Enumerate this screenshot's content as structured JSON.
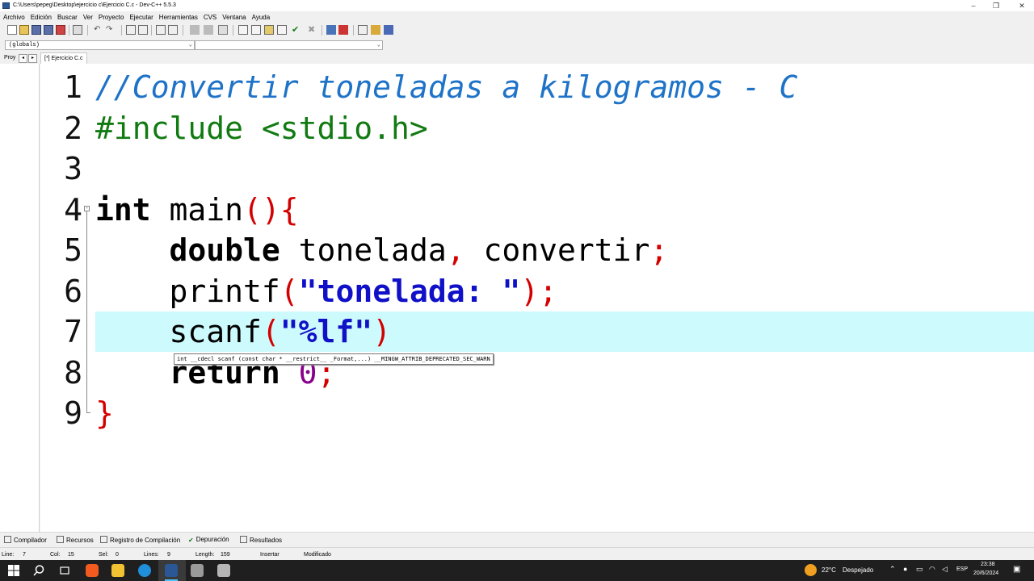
{
  "window": {
    "title": "C:\\Users\\pepeg\\Desktop\\ejercicio  c\\Ejercicio C.c - Dev-C++ 5.5.3",
    "controls": [
      "–",
      "❐",
      "✕"
    ]
  },
  "menu": [
    "Archivo",
    "Edición",
    "Buscar",
    "Ver",
    "Proyecto",
    "Ejecutar",
    "Herramientas",
    "CVS",
    "Ventana",
    "Ayuda"
  ],
  "selectors": {
    "scope": "(globals)",
    "member": ""
  },
  "tabs": {
    "project_tab": "Proy",
    "file_tab": "[*] Ejercicio C.c"
  },
  "editor": {
    "line_numbers": [
      "1",
      "2",
      "3",
      "4",
      "5",
      "6",
      "7",
      "8",
      "9"
    ],
    "lines": {
      "l1_comment": "//Convertir toneladas a kilogramos - C",
      "l2_include": "#include <stdio.h>",
      "l4_type": "int",
      "l4_name": " main",
      "l4_parens": "()",
      "l4_brace": "{",
      "l5_indent": "    ",
      "l5_type": "double",
      "l5_var1": " tonelada",
      "l5_comma": ",",
      "l5_var2": " convertir",
      "l5_semi": ";",
      "l6_func": "printf",
      "l6_open": "(",
      "l6_str": "\"tonelada: \"",
      "l6_close": ");",
      "l7_func": "scanf",
      "l7_open": "(",
      "l7_str": "\"%lf\"",
      "l7_close": ")",
      "l8_kw": "return",
      "l8_num": " 0",
      "l8_semi": ";",
      "l9_brace": "}"
    },
    "tooltip": "int __cdecl scanf (const char * __restrict__ _Format,...) __MINGW_ATTRIB_DEPRECATED_SEC_WARN"
  },
  "bottom_tabs": [
    "Compilador",
    "Recursos",
    "Registro de Compilación",
    "Depuración",
    "Resultados"
  ],
  "status": {
    "line_label": "Line:",
    "line_value": "7",
    "col_label": "Col:",
    "col_value": "15",
    "sel_label": "Sel:",
    "sel_value": "0",
    "lines_label": "Lines:",
    "lines_value": "9",
    "length_label": "Length:",
    "length_value": "159",
    "mode": "Insertar",
    "state": "Modificado"
  },
  "taskbar": {
    "weather_temp": "22°C",
    "weather_desc": "Despejado",
    "lang": "ESP",
    "time": "23:38",
    "date": "20/6/2024"
  }
}
